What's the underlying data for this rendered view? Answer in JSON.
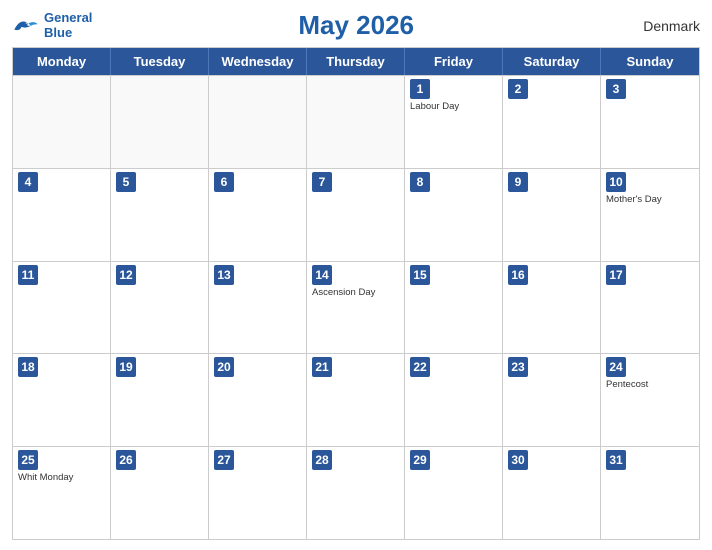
{
  "header": {
    "logo_line1": "General",
    "logo_line2": "Blue",
    "title": "May 2026",
    "country": "Denmark"
  },
  "weekdays": [
    "Monday",
    "Tuesday",
    "Wednesday",
    "Thursday",
    "Friday",
    "Saturday",
    "Sunday"
  ],
  "rows": [
    [
      {
        "date": "",
        "event": ""
      },
      {
        "date": "",
        "event": ""
      },
      {
        "date": "",
        "event": ""
      },
      {
        "date": "",
        "event": ""
      },
      {
        "date": "1",
        "event": "Labour Day"
      },
      {
        "date": "2",
        "event": ""
      },
      {
        "date": "3",
        "event": ""
      }
    ],
    [
      {
        "date": "4",
        "event": ""
      },
      {
        "date": "5",
        "event": ""
      },
      {
        "date": "6",
        "event": ""
      },
      {
        "date": "7",
        "event": ""
      },
      {
        "date": "8",
        "event": ""
      },
      {
        "date": "9",
        "event": ""
      },
      {
        "date": "10",
        "event": "Mother's Day"
      }
    ],
    [
      {
        "date": "11",
        "event": ""
      },
      {
        "date": "12",
        "event": ""
      },
      {
        "date": "13",
        "event": ""
      },
      {
        "date": "14",
        "event": "Ascension Day"
      },
      {
        "date": "15",
        "event": ""
      },
      {
        "date": "16",
        "event": ""
      },
      {
        "date": "17",
        "event": ""
      }
    ],
    [
      {
        "date": "18",
        "event": ""
      },
      {
        "date": "19",
        "event": ""
      },
      {
        "date": "20",
        "event": ""
      },
      {
        "date": "21",
        "event": ""
      },
      {
        "date": "22",
        "event": ""
      },
      {
        "date": "23",
        "event": ""
      },
      {
        "date": "24",
        "event": "Pentecost"
      }
    ],
    [
      {
        "date": "25",
        "event": "Whit Monday"
      },
      {
        "date": "26",
        "event": ""
      },
      {
        "date": "27",
        "event": ""
      },
      {
        "date": "28",
        "event": ""
      },
      {
        "date": "29",
        "event": ""
      },
      {
        "date": "30",
        "event": ""
      },
      {
        "date": "31",
        "event": ""
      }
    ]
  ]
}
